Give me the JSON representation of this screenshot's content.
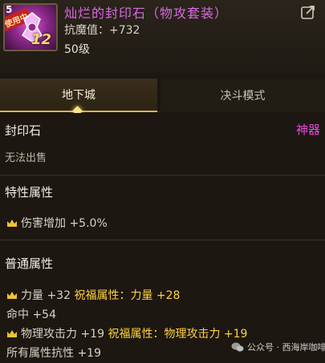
{
  "item": {
    "icon_top_number": "5",
    "icon_tag": "使用中",
    "icon_level": "12",
    "title": "灿烂的封印石（物攻套装）",
    "stat": "抗魔值：+732",
    "level": "50级"
  },
  "tabs": [
    {
      "label": "地下城",
      "active": true
    },
    {
      "label": "决斗模式",
      "active": false
    }
  ],
  "details": {
    "type": "封印石",
    "rarity": "神器",
    "trade": "无法出售",
    "special_header": "特性属性",
    "special_lines": [
      {
        "text": "伤害增加 +5.0%"
      }
    ],
    "general_header": "普通属性",
    "general_lines": [
      {
        "crown": true,
        "main": "力量 +32",
        "blessing": "祝福属性：力量 +28"
      },
      {
        "crown": false,
        "main": "命中 +54",
        "blessing": ""
      },
      {
        "crown": true,
        "main": "物理攻击力 +19",
        "blessing": "祝福属性：物理攻击力 +19"
      },
      {
        "crown": false,
        "main": "所有属性抗性 +19",
        "blessing": ""
      }
    ]
  },
  "watermark": {
    "text": "公众号 · 西海岸咖啡馆"
  },
  "colors": {
    "title_purple": "#d86ae0",
    "rarity_magenta": "#e14bd6",
    "blessing_gold": "#ffd23e",
    "tab_active_bg": "#3a2e1c",
    "background": "#1c1710"
  }
}
